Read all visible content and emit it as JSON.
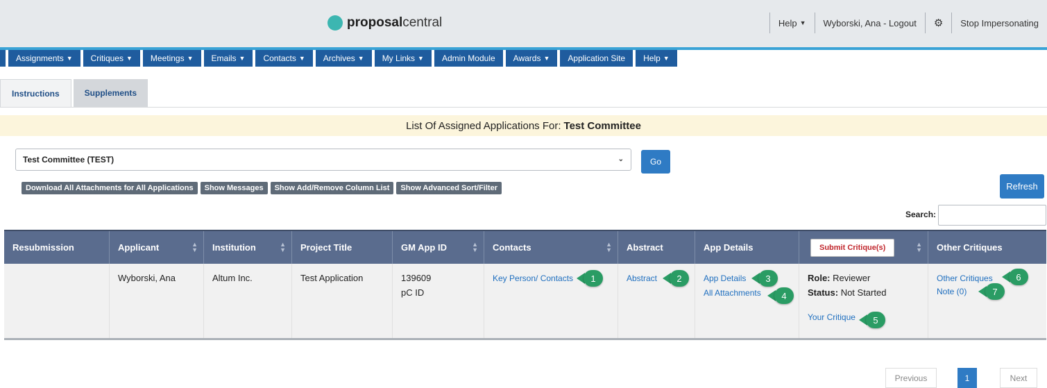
{
  "header": {
    "logo_bold": "proposal",
    "logo_light": "central",
    "help": "Help",
    "user": "Wyborski, Ana - Logout",
    "stop": "Stop Impersonating"
  },
  "nav": {
    "items": [
      "Assignments",
      "Critiques",
      "Meetings",
      "Emails",
      "Contacts",
      "Archives",
      "My Links",
      "Admin Module",
      "Awards",
      "Application Site",
      "Help"
    ]
  },
  "tabs": [
    "Instructions",
    "Supplements"
  ],
  "banner": {
    "prefix": "List Of Assigned Applications For:",
    "committee": "Test Committee"
  },
  "committee_select": {
    "value": "Test Committee (TEST)",
    "go": "Go"
  },
  "actions": [
    "Download All Attachments for All Applications",
    "Show Messages",
    "Show Add/Remove Column List",
    "Show Advanced Sort/Filter"
  ],
  "refresh": "Refresh",
  "search": {
    "label": "Search:"
  },
  "table": {
    "columns": [
      "Resubmission",
      "Applicant",
      "Institution",
      "Project Title",
      "GM App ID",
      "Contacts",
      "Abstract",
      "App Details",
      "Submit Critique(s)",
      "Other Critiques"
    ],
    "row": {
      "resubmission": "",
      "applicant": "Wyborski, Ana",
      "institution": "Altum Inc.",
      "project_title": "Test Application",
      "gm_app_id": "139609",
      "pc_id": "pC ID",
      "contacts_link": "Key Person/ Contacts",
      "abstract_link": "Abstract",
      "app_details_link": "App Details",
      "attachments_link": "All Attachments",
      "role_label": "Role:",
      "role_value": "Reviewer",
      "status_label": "Status:",
      "status_value": "Not Started",
      "your_critique": "Your Critique",
      "other_critiques_link": "Other Critiques",
      "note_link": "Note (0)"
    }
  },
  "callouts": [
    "1",
    "2",
    "3",
    "4",
    "5",
    "6",
    "7"
  ],
  "pagination": {
    "previous": "Previous",
    "page": "1",
    "next": "Next"
  },
  "colors": {
    "nav": "#1f5c9e",
    "header_row": "#5a6c8e",
    "callout": "#2a9c64",
    "banner": "#fcf5dc",
    "accent_line": "#3aa3d6"
  }
}
